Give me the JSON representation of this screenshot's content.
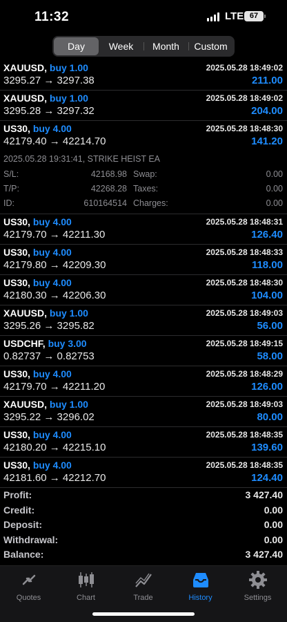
{
  "status": {
    "time": "11:32",
    "network": "LTE",
    "battery": "67"
  },
  "periods": [
    "Day",
    "Week",
    "Month",
    "Custom"
  ],
  "trades_top": [
    {
      "symbol": "XAUUSD,",
      "side": "buy 1.00",
      "date": "2025.05.28 18:49:02",
      "prices": "3295.27 → 3297.38",
      "profit": "211.00"
    },
    {
      "symbol": "XAUUSD,",
      "side": "buy 1.00",
      "date": "2025.05.28 18:49:02",
      "prices": "3295.28 → 3297.32",
      "profit": "204.00"
    },
    {
      "symbol": "US30,",
      "side": "buy 4.00",
      "date": "2025.05.28 18:48:30",
      "prices": "42179.40 → 42214.70",
      "profit": "141.20"
    }
  ],
  "detail": {
    "header": "2025.05.28 19:31:41, STRIKE HEIST EA",
    "sl_label": "S/L:",
    "sl": "42168.98",
    "tp_label": "T/P:",
    "tp": "42268.28",
    "id_label": "ID:",
    "id": "610164514",
    "swap_label": "Swap:",
    "swap": "0.00",
    "taxes_label": "Taxes:",
    "taxes": "0.00",
    "charges_label": "Charges:",
    "charges": "0.00"
  },
  "trades_bottom": [
    {
      "symbol": "US30,",
      "side": "buy 4.00",
      "date": "2025.05.28 18:48:31",
      "prices": "42179.70 → 42211.30",
      "profit": "126.40"
    },
    {
      "symbol": "US30,",
      "side": "buy 4.00",
      "date": "2025.05.28 18:48:33",
      "prices": "42179.80 → 42209.30",
      "profit": "118.00"
    },
    {
      "symbol": "US30,",
      "side": "buy 4.00",
      "date": "2025.05.28 18:48:30",
      "prices": "42180.30 → 42206.30",
      "profit": "104.00"
    },
    {
      "symbol": "XAUUSD,",
      "side": "buy 1.00",
      "date": "2025.05.28 18:49:03",
      "prices": "3295.26 → 3295.82",
      "profit": "56.00"
    },
    {
      "symbol": "USDCHF,",
      "side": "buy 3.00",
      "date": "2025.05.28 18:49:15",
      "prices": "0.82737 → 0.82753",
      "profit": "58.00"
    },
    {
      "symbol": "US30,",
      "side": "buy 4.00",
      "date": "2025.05.28 18:48:29",
      "prices": "42179.70 → 42211.20",
      "profit": "126.00"
    },
    {
      "symbol": "XAUUSD,",
      "side": "buy 1.00",
      "date": "2025.05.28 18:49:03",
      "prices": "3295.22 → 3296.02",
      "profit": "80.00"
    },
    {
      "symbol": "US30,",
      "side": "buy 4.00",
      "date": "2025.05.28 18:48:35",
      "prices": "42180.20 → 42215.10",
      "profit": "139.60"
    },
    {
      "symbol": "US30,",
      "side": "buy 4.00",
      "date": "2025.05.28 18:48:35",
      "prices": "42181.60 → 42212.70",
      "profit": "124.40"
    }
  ],
  "summary": [
    {
      "label": "Profit:",
      "value": "3 427.40"
    },
    {
      "label": "Credit:",
      "value": "0.00"
    },
    {
      "label": "Deposit:",
      "value": "0.00"
    },
    {
      "label": "Withdrawal:",
      "value": "0.00"
    },
    {
      "label": "Balance:",
      "value": "3 427.40"
    }
  ],
  "tabs": [
    {
      "label": "Quotes",
      "icon": "quotes-icon"
    },
    {
      "label": "Chart",
      "icon": "chart-icon"
    },
    {
      "label": "Trade",
      "icon": "trade-icon"
    },
    {
      "label": "History",
      "icon": "history-icon"
    },
    {
      "label": "Settings",
      "icon": "gear-icon"
    }
  ],
  "colors": {
    "accent": "#1e8cff",
    "background": "#000000",
    "muted": "#8e8e93"
  }
}
